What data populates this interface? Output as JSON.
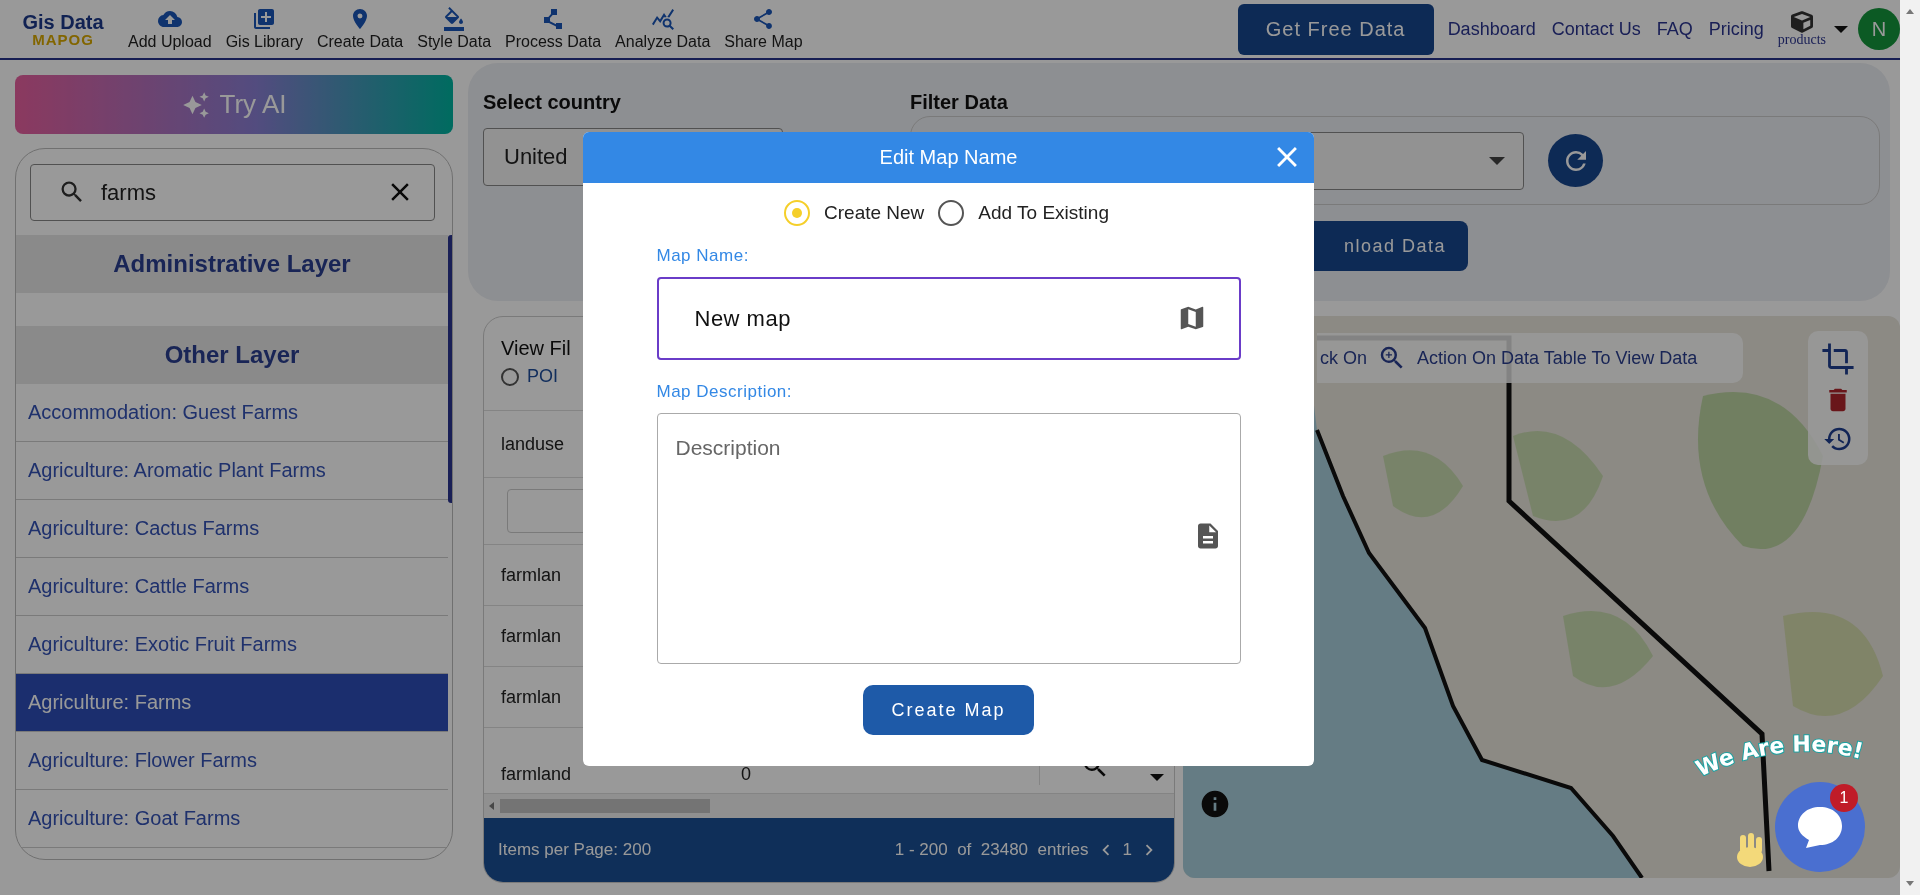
{
  "header": {
    "logo": {
      "title": "Gis Data",
      "subtitle": "MAPOG"
    },
    "nav": [
      {
        "kind": "upload",
        "label": "Add Upload"
      },
      {
        "kind": "library",
        "label": "Gis Library"
      },
      {
        "kind": "create",
        "label": "Create Data"
      },
      {
        "kind": "style",
        "label": "Style Data"
      },
      {
        "kind": "process",
        "label": "Process Data"
      },
      {
        "kind": "analyze",
        "label": "Analyze Data"
      },
      {
        "kind": "share",
        "label": "Share Map"
      }
    ],
    "cta": "Get Free Data",
    "links": [
      "Dashboard",
      "Contact Us",
      "FAQ",
      "Pricing"
    ],
    "products": "products",
    "avatar": "N"
  },
  "sidebar": {
    "try_ai": "Try AI",
    "search": {
      "value": "farms"
    },
    "sections": [
      {
        "title": "Administrative Layer"
      },
      {
        "title": "Other Layer",
        "items": [
          {
            "label": "Accommodation: Guest Farms",
            "selected": false
          },
          {
            "label": "Agriculture: Aromatic Plant Farms",
            "selected": false
          },
          {
            "label": "Agriculture: Cactus Farms",
            "selected": false
          },
          {
            "label": "Agriculture: Cattle Farms",
            "selected": false
          },
          {
            "label": "Agriculture: Exotic Fruit Farms",
            "selected": false
          },
          {
            "label": "Agriculture: Farms",
            "selected": true
          },
          {
            "label": "Agriculture: Flower Farms",
            "selected": false
          },
          {
            "label": "Agriculture: Goat Farms",
            "selected": false
          }
        ]
      }
    ]
  },
  "filters": {
    "country": {
      "label": "Select country",
      "value": "United"
    },
    "filter": {
      "label": "Filter Data"
    },
    "download": "nload Data"
  },
  "table": {
    "title": "View Fil",
    "geometry_option": {
      "label": "POI",
      "selected": false
    },
    "header_cell": "landuse",
    "rows": [
      {
        "cells": [
          "farmlan"
        ]
      },
      {
        "cells": [
          "farmlan"
        ]
      },
      {
        "cells": [
          "farmlan"
        ]
      },
      {
        "cells": [
          "farmland",
          "0"
        ]
      }
    ],
    "footer": {
      "per_page": "Items per Page: 200",
      "range": "1 - 200  of  23480  entries",
      "page": "1"
    }
  },
  "map": {
    "hint": {
      "lead": "ck On",
      "text": "Action On Data Table To View Data"
    }
  },
  "chat": {
    "greeting": "We Are Here!",
    "badge": "1"
  },
  "dialog": {
    "title": "Edit Map Name",
    "modes": [
      {
        "label": "Create New",
        "selected": true
      },
      {
        "label": "Add To Existing",
        "selected": false
      }
    ],
    "name": {
      "label": "Map Name:",
      "value": "New map"
    },
    "description": {
      "label": "Map Description:",
      "placeholder": "Description"
    },
    "submit": "Create Map"
  }
}
